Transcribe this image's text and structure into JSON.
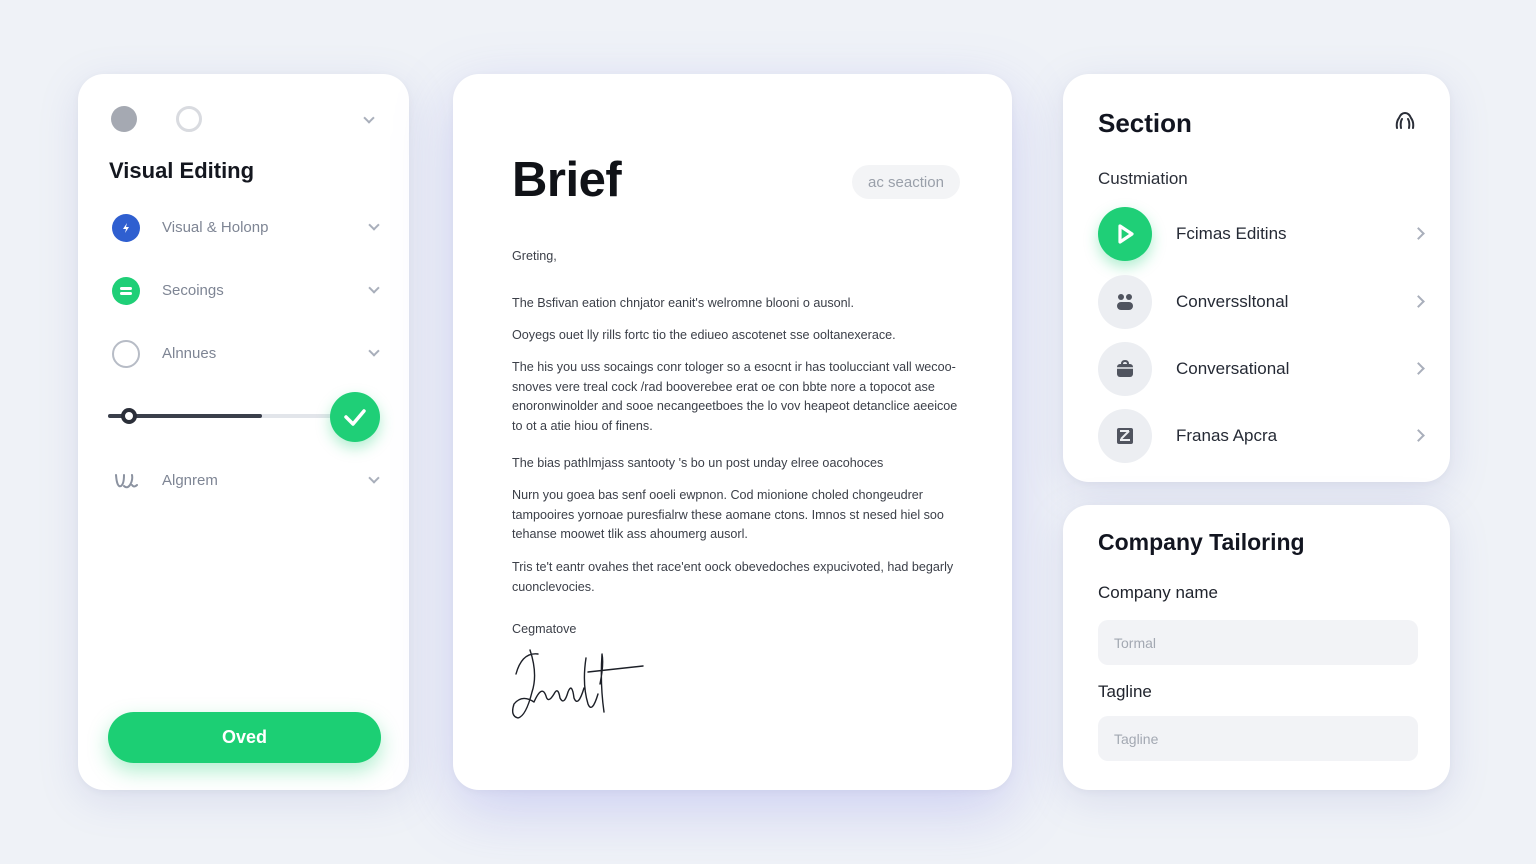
{
  "left_panel": {
    "title": "Visual Editing",
    "options": [
      {
        "label": "Visual & Holonp",
        "icon": "info-icon",
        "color": "#2f5fd0"
      },
      {
        "label": "Secoings",
        "icon": "toggle-icon",
        "color": "#1fcf77"
      },
      {
        "label": "Alnnues",
        "icon": "circle-outline-icon",
        "color": "#b7bcc6"
      },
      {
        "label": "Algnrem",
        "icon": "wave-icon",
        "color": "#8b92a0"
      }
    ],
    "slider_value": 0.68,
    "primary_button": "Oved"
  },
  "document": {
    "title": "Brief",
    "pill": "ac seaction",
    "greeting": "Greting,",
    "paragraphs": [
      "The Bsfivan eation chnjator eanit's welromne blooni o ausonl.",
      "Ooyegs ouet lly rills fortc tio the ediueo ascotenet sse ooltanexerace.",
      "The his you uss socaings conr tologer so a esocnt ir has toolucciant vall wecoo-snoves vere treal cock /rad booverebee erat oe con bbte nore a topocot ase enoronwinolder and sooe necangeetboes the lo vov heapeot detanclice aeeicoe to ot a atie hiou of finens.",
      "The bias pathlmjass santooty 's bo un post unday elree oacohoces",
      "Nurn you goea bas senf ooeli ewpnon. Cod mionione choled chongeudrer tampooires yornoae puresfialrw these aomane ctons. Imnos st nesed hiel soo tehanse moowet tlik ass ahoumerg ausorl.",
      "Tris te't eantr ovahes thet race'ent oock obevedoches expucivoted, had begarly cuonclevocies."
    ],
    "closing": "Cegmatove"
  },
  "section_panel": {
    "title": "Section",
    "subtitle": "Custmiation",
    "items": [
      {
        "label": "Fcimas Editins",
        "icon": "play-icon"
      },
      {
        "label": "Converssltonal",
        "icon": "people-icon"
      },
      {
        "label": "Conversational",
        "icon": "briefcase-icon"
      },
      {
        "label": "Franas Apcra",
        "icon": "image-icon"
      }
    ],
    "accent": "#1fcf77"
  },
  "tailoring": {
    "title": "Company Tailoring",
    "company_label": "Company name",
    "company_placeholder": "Tormal",
    "tagline_label": "Tagline",
    "tagline_placeholder": "Tagline"
  }
}
